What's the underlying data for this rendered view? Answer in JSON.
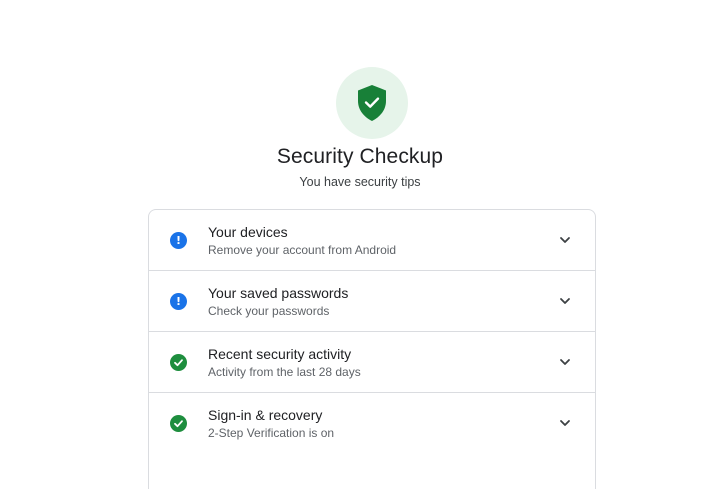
{
  "header": {
    "title": "Security Checkup",
    "subtitle": "You have security tips",
    "badge_icon": "shield-check-icon"
  },
  "colors": {
    "shield": "#188038",
    "badge_bg": "#e6f4ea",
    "alert": "#1a73e8",
    "ok": "#1e8e3e"
  },
  "items": [
    {
      "title": "Your devices",
      "description": "Remove your account from Android",
      "status": "alert",
      "icon": "exclamation-icon"
    },
    {
      "title": "Your saved passwords",
      "description": "Check your passwords",
      "status": "alert",
      "icon": "exclamation-icon"
    },
    {
      "title": "Recent security activity",
      "description": "Activity from the last 28 days",
      "status": "ok",
      "icon": "check-icon"
    },
    {
      "title": "Sign-in & recovery",
      "description": "2-Step Verification is on",
      "status": "ok",
      "icon": "check-icon"
    }
  ]
}
